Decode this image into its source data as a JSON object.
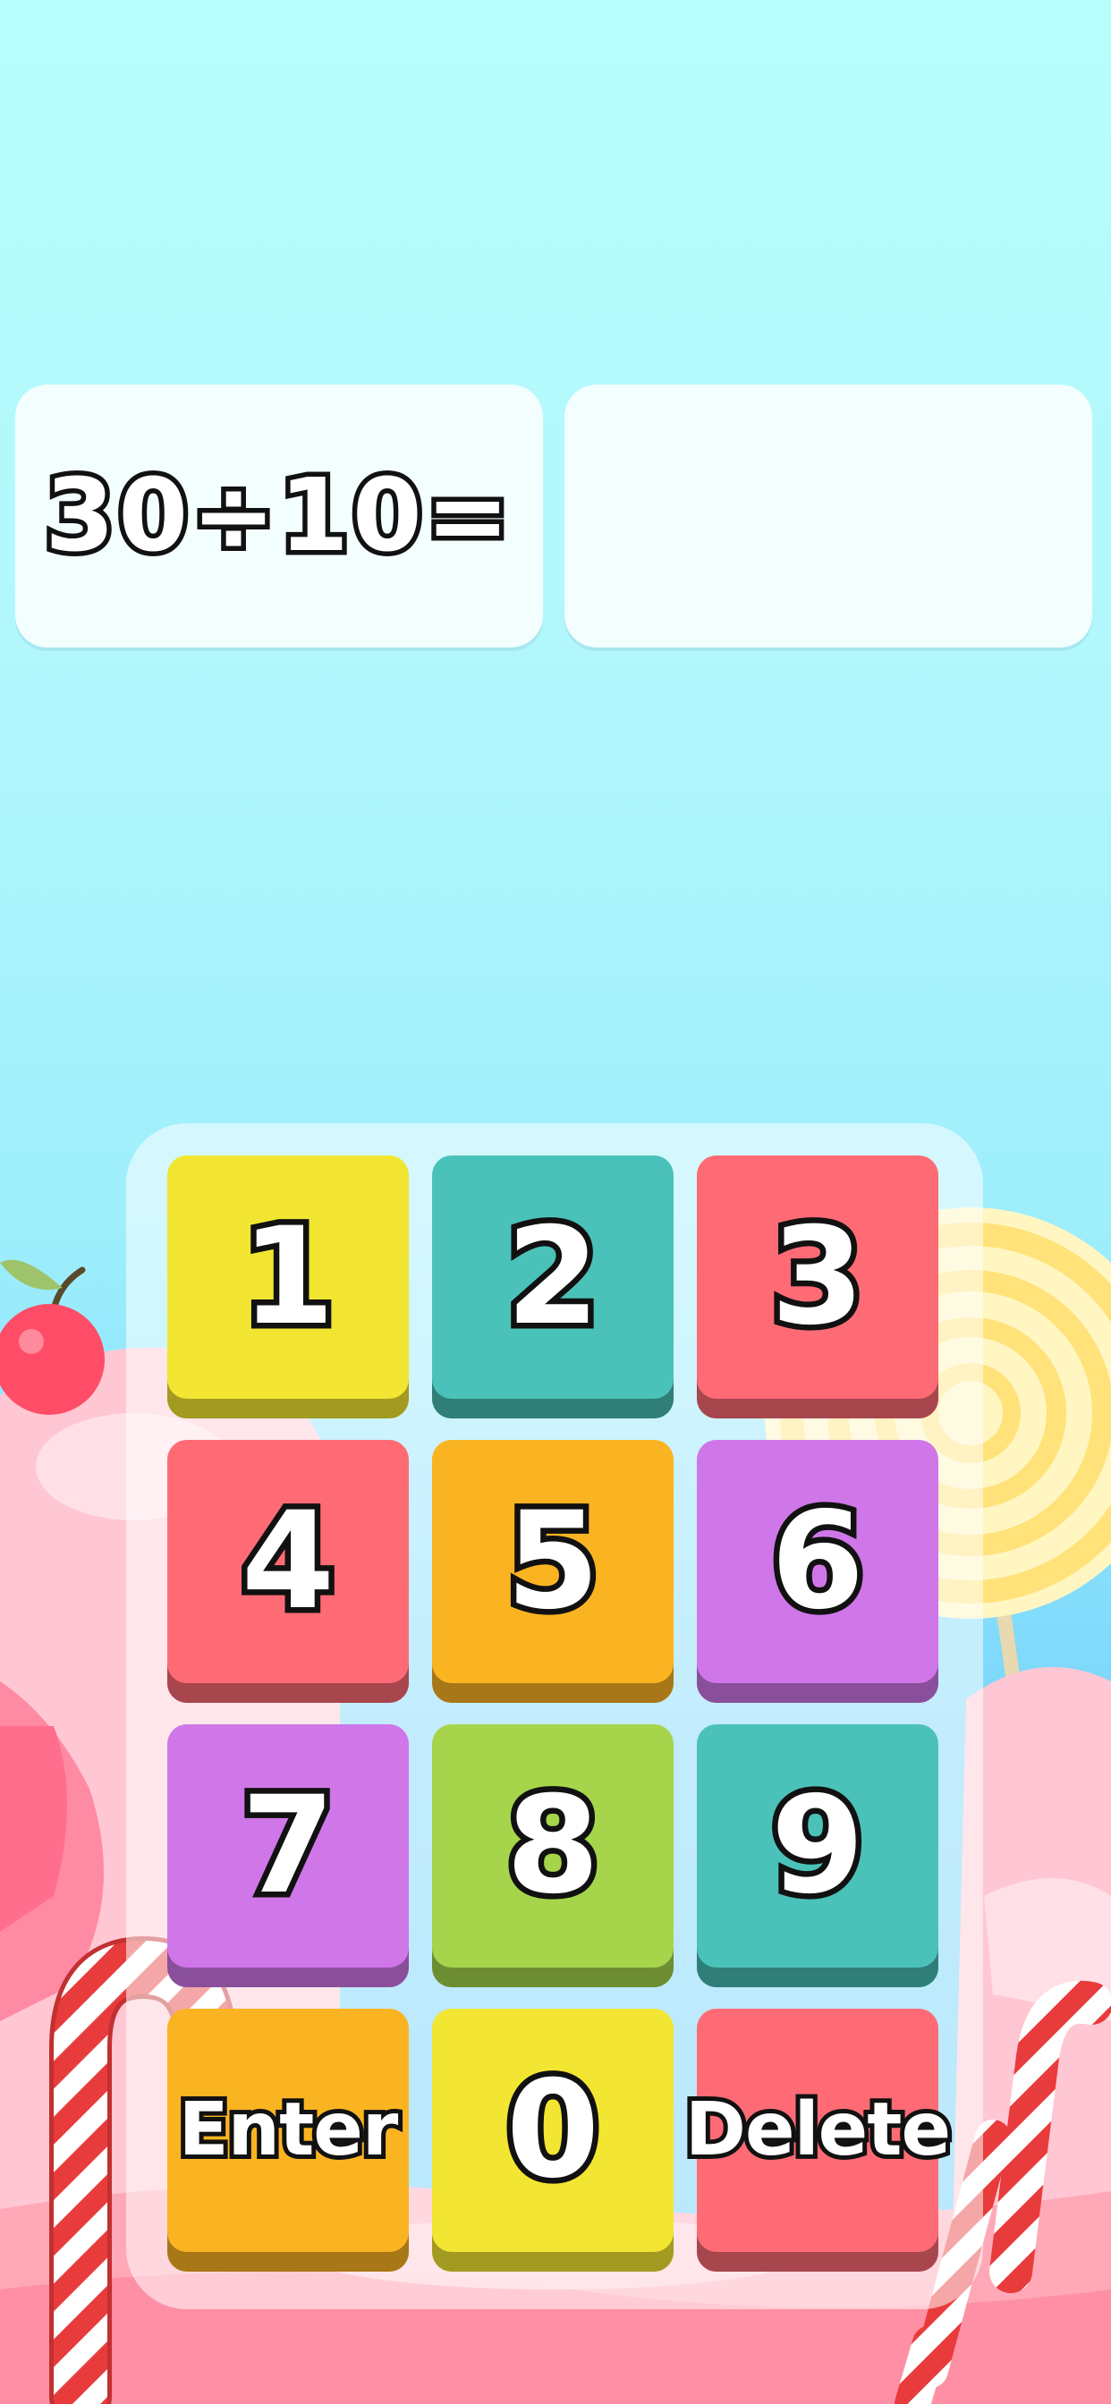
{
  "question": {
    "text": "30÷10="
  },
  "answer": {
    "text": ""
  },
  "keypad": {
    "keys": [
      {
        "label": "1",
        "color": "#f2e632"
      },
      {
        "label": "2",
        "color": "#4bc2b9"
      },
      {
        "label": "3",
        "color": "#ff6b75"
      },
      {
        "label": "4",
        "color": "#ff6b75"
      },
      {
        "label": "5",
        "color": "#fbb421"
      },
      {
        "label": "6",
        "color": "#cf77e8"
      },
      {
        "label": "7",
        "color": "#cf77e8"
      },
      {
        "label": "8",
        "color": "#a6d54c"
      },
      {
        "label": "9",
        "color": "#4bc2b9"
      },
      {
        "label": "Enter",
        "color": "#fbb421"
      },
      {
        "label": "0",
        "color": "#f2e632"
      },
      {
        "label": "Delete",
        "color": "#ff6b75"
      }
    ]
  },
  "icons": {
    "cherry": "cherry-icon",
    "lollipop": "lollipop-icon",
    "candy_cane": "candy-cane-icon"
  },
  "colors": {
    "sky_top": "#b8fefd",
    "sky_bottom": "#5ec7f8",
    "candy_pink": "#ffb3c4",
    "stroke": "#111111"
  }
}
